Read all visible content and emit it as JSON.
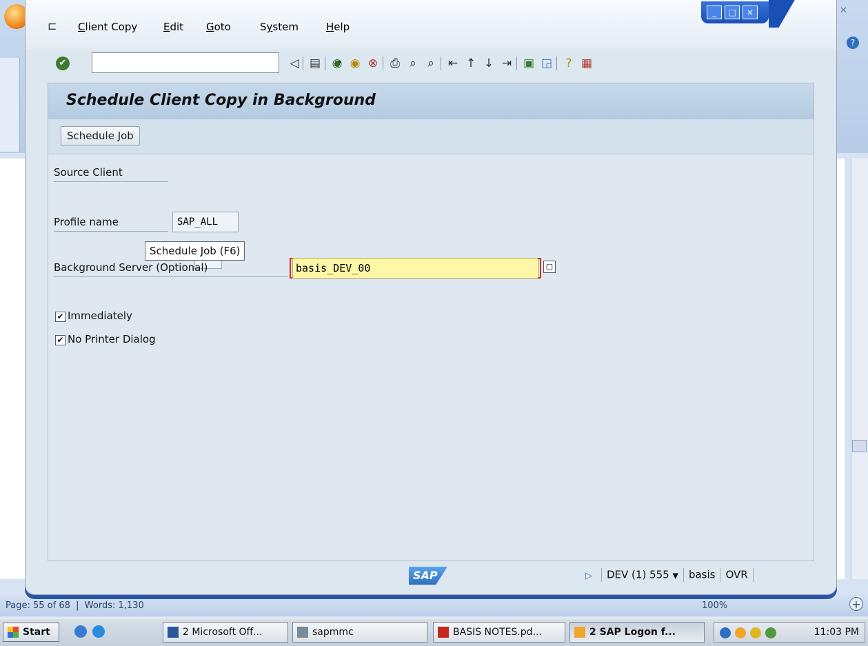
{
  "word": {
    "status_page": "Page: 55 of 68",
    "status_words": "Words: 1,130",
    "zoom": "100%"
  },
  "sap": {
    "menu": [
      {
        "label": "Client Copy",
        "accel": "C"
      },
      {
        "label": "Edit",
        "accel": "E"
      },
      {
        "label": "Goto",
        "accel": "G"
      },
      {
        "label": "System",
        "accel": "S"
      },
      {
        "label": "Help",
        "accel": "H"
      }
    ],
    "command_field": "",
    "screen_title": "Schedule Client Copy in Background",
    "schedule_button": "Schedule Job",
    "tooltip": "Schedule Job   (F6)",
    "fields": {
      "source_client_label": "Source Client",
      "profile_name_label": "Profile name",
      "profile_name_value": "SAP_ALL",
      "bg_server_label": "Background Server (Optional)",
      "bg_server_value": "basis_DEV_00"
    },
    "checkboxes": {
      "immediately": {
        "label": "Immediately",
        "checked": true
      },
      "no_printer_dialog": {
        "label": "No Printer Dialog",
        "checked": true
      }
    },
    "logo_text": "SAP",
    "status": {
      "system": "DEV (1) 555",
      "server": "basis",
      "mode": "OVR"
    }
  },
  "taskbar": {
    "start": "Start",
    "tasks": [
      {
        "label": "2 Microsoft Off...",
        "icon": "word-icon"
      },
      {
        "label": "sapmmc",
        "icon": "mmc-icon"
      },
      {
        "label": "BASIS NOTES.pd...",
        "icon": "pdf-icon"
      },
      {
        "label": "2 SAP Logon f...",
        "icon": "sap-logon-icon"
      }
    ],
    "clock": "11:03 PM"
  },
  "colors": {
    "required_field_bg": "#fff7a8",
    "sap_panel_bg": "#dfe8f0",
    "title_bar_blue": "#1a4fb5"
  }
}
